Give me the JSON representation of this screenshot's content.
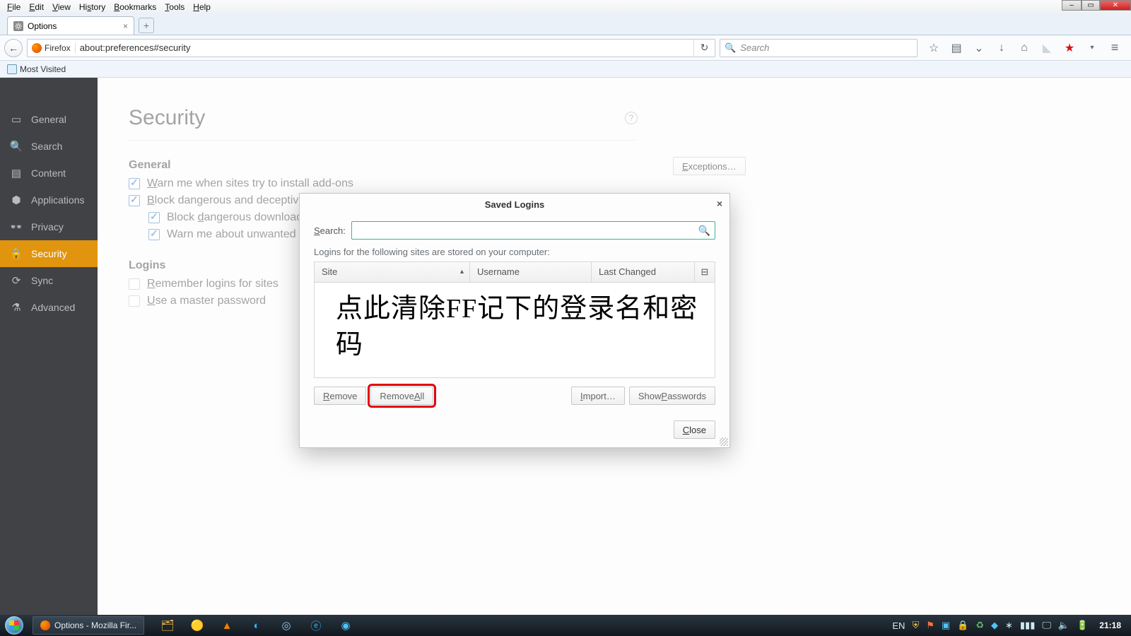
{
  "menubar": {
    "file": "File",
    "edit": "Edit",
    "view": "View",
    "history": "History",
    "bookmarks": "Bookmarks",
    "tools": "Tools",
    "help": "Help"
  },
  "tab": {
    "title": "Options"
  },
  "urlbar": {
    "identity": "Firefox",
    "url": "about:preferences#security"
  },
  "searchbar": {
    "placeholder": "Search"
  },
  "bookmarks_toolbar": {
    "most_visited": "Most Visited"
  },
  "sidebar": {
    "items": [
      {
        "label": "General"
      },
      {
        "label": "Search"
      },
      {
        "label": "Content"
      },
      {
        "label": "Applications"
      },
      {
        "label": "Privacy"
      },
      {
        "label": "Security"
      },
      {
        "label": "Sync"
      },
      {
        "label": "Advanced"
      }
    ]
  },
  "page": {
    "title": "Security",
    "general_heading": "General",
    "warn_addons": "Warn me when sites try to install add-ons",
    "block_dangerous": "Block dangerous and deceptive content",
    "block_downloads": "Block dangerous downloads",
    "warn_unwanted": "Warn me about unwanted and uncommon software",
    "exceptions_btn": "Exceptions…",
    "logins_heading": "Logins",
    "remember_logins": "Remember logins for sites",
    "use_master": "Use a master password"
  },
  "dialog": {
    "title": "Saved Logins",
    "search_label": "Search:",
    "desc": "Logins for the following sites are stored on your computer:",
    "col_site": "Site",
    "col_user": "Username",
    "col_last": "Last Changed",
    "annotation": "点此清除FF记下的登录名和密码",
    "btn_remove": "Remove",
    "btn_remove_all": "Remove All",
    "btn_import": "Import…",
    "btn_show": "Show Passwords",
    "btn_close": "Close"
  },
  "taskbar": {
    "firefox_task": "Options - Mozilla Fir...",
    "lang": "EN",
    "clock": "21:18"
  }
}
